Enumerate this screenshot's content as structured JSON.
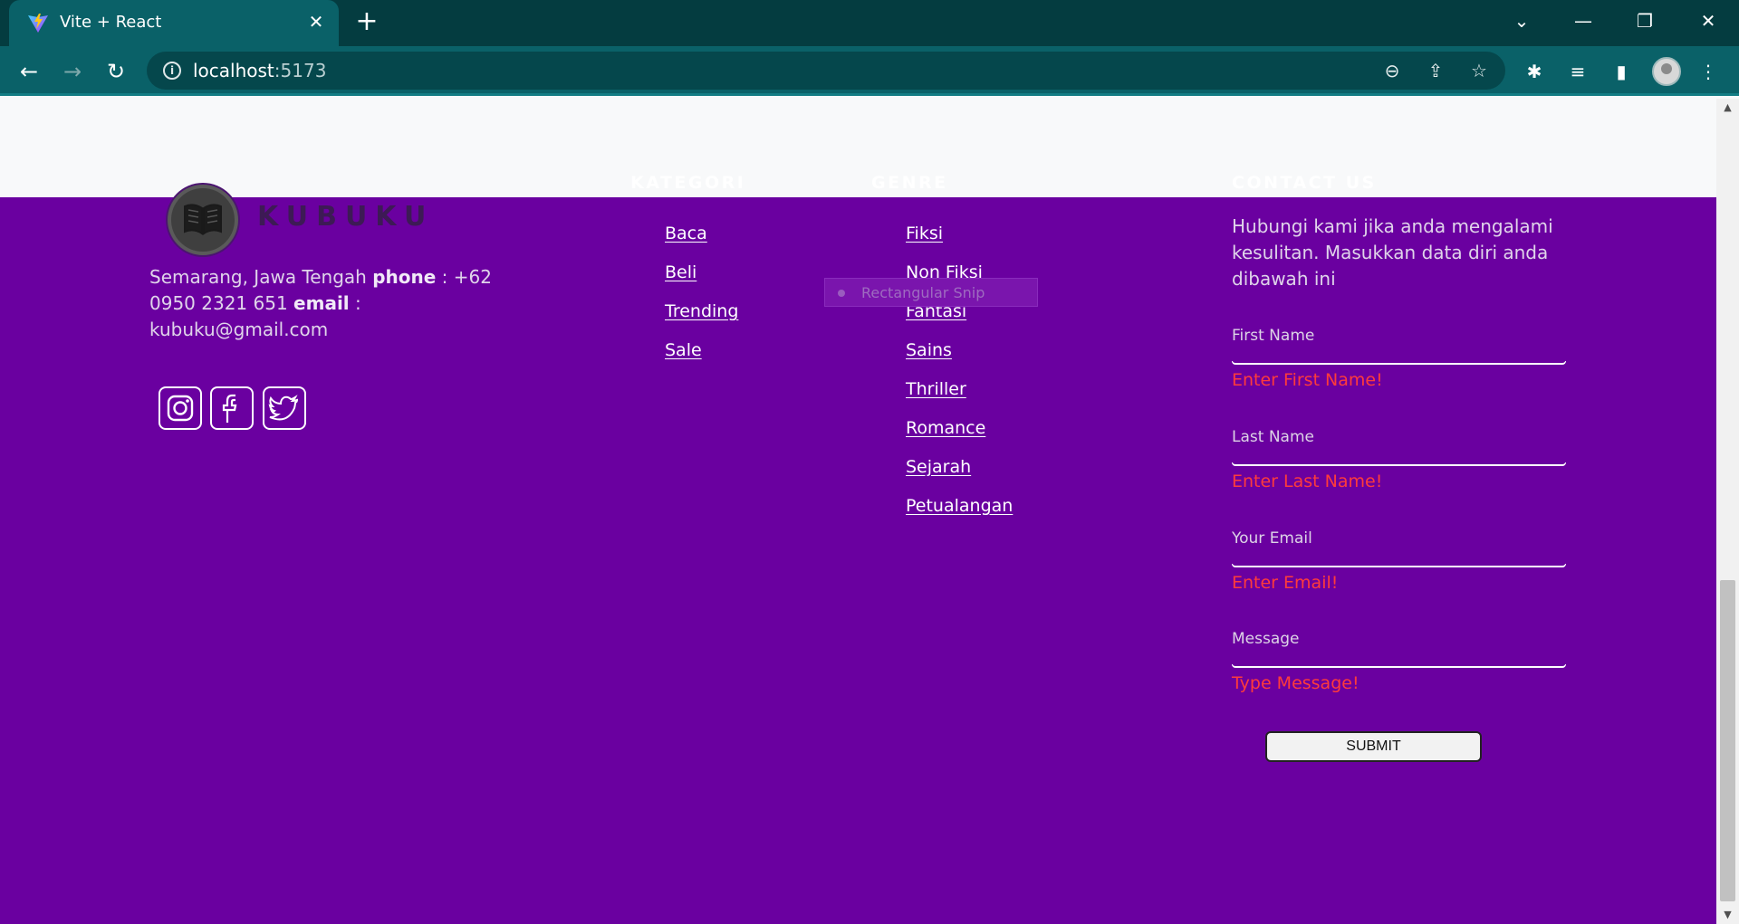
{
  "browser": {
    "tab_title": "Vite + React",
    "url_host": "localhost",
    "url_port": ":5173"
  },
  "brand": {
    "name": "KUBUKU",
    "address_pre": "Semarang, Jawa Tengah ",
    "phone_label": "phone",
    "phone_value": " : +62 0950 2321 651 ",
    "email_label": "email",
    "email_value": " : kubuku@gmail.com"
  },
  "social": [
    {
      "icon": "instagram-icon"
    },
    {
      "icon": "facebook-icon"
    },
    {
      "icon": "twitter-icon"
    }
  ],
  "kategori": {
    "heading": "KATEGORI",
    "items": [
      "Baca",
      "Beli",
      "Trending",
      "Sale"
    ]
  },
  "genre": {
    "heading": "GENRE",
    "items": [
      "Fiksi",
      "Non Fiksi",
      "Fantasi",
      "Sains",
      "Thriller",
      "Romance",
      "Sejarah",
      "Petualangan"
    ]
  },
  "contact": {
    "heading": "CONTACT US",
    "text": "Hubungi kami jika anda mengalami kesulitan. Masukkan data diri anda dibawah ini",
    "fields": [
      {
        "label": "First Name",
        "error": "Enter First Name!"
      },
      {
        "label": "Last Name",
        "error": "Enter Last Name!"
      },
      {
        "label": "Your Email",
        "error": "Enter Email!"
      },
      {
        "label": "Message",
        "error": "Type Message!"
      }
    ],
    "submit_label": "SUBMIT"
  },
  "overlay": {
    "snip_label": "Rectangular Snip"
  },
  "colors": {
    "footer_bg": "#6a00a0",
    "error": "#ff3b3b",
    "chrome_tab": "#0a6168",
    "chrome_bar": "#043c40"
  }
}
